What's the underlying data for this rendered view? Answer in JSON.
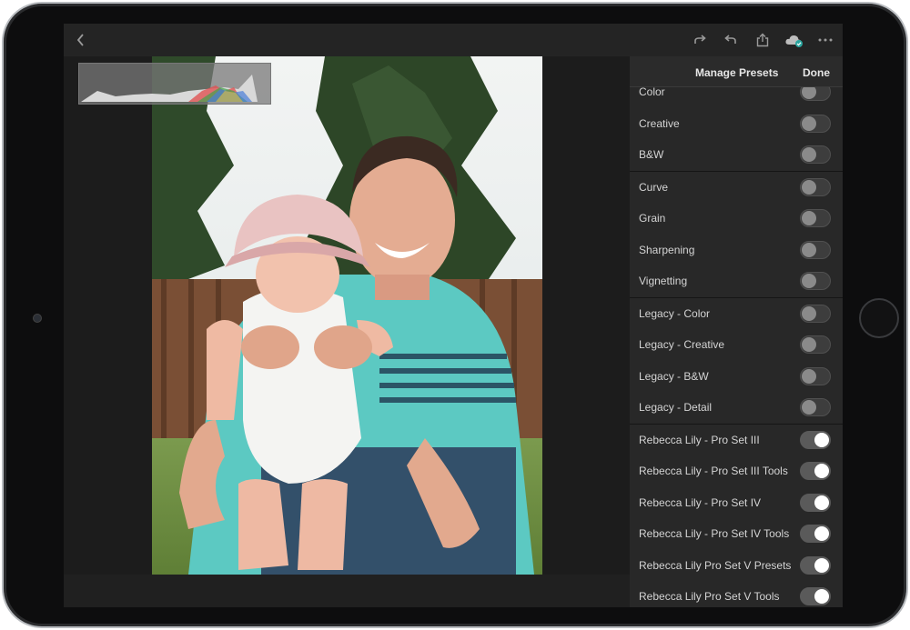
{
  "header": {
    "title": "Manage Presets",
    "done_label": "Done"
  },
  "toolbar": {
    "icons": [
      "back-icon",
      "redo-icon",
      "undo-icon",
      "share-icon",
      "cloud-sync-icon",
      "more-icon"
    ]
  },
  "colors": {
    "panel_bg": "#282828",
    "toggle_on": "#ffffff",
    "toggle_off": "#8a8a8a"
  },
  "presets": {
    "groups": [
      {
        "items": [
          {
            "label": "Color",
            "on": false
          },
          {
            "label": "Creative",
            "on": false
          },
          {
            "label": "B&W",
            "on": false
          }
        ]
      },
      {
        "items": [
          {
            "label": "Curve",
            "on": false
          },
          {
            "label": "Grain",
            "on": false
          },
          {
            "label": "Sharpening",
            "on": false
          },
          {
            "label": "Vignetting",
            "on": false
          }
        ]
      },
      {
        "items": [
          {
            "label": "Legacy - Color",
            "on": false
          },
          {
            "label": "Legacy - Creative",
            "on": false
          },
          {
            "label": "Legacy - B&W",
            "on": false
          },
          {
            "label": "Legacy - Detail",
            "on": false
          }
        ]
      },
      {
        "items": [
          {
            "label": "Rebecca Lily - Pro Set III",
            "on": true
          },
          {
            "label": "Rebecca Lily - Pro Set III Tools",
            "on": true
          },
          {
            "label": "Rebecca Lily - Pro Set IV",
            "on": true
          },
          {
            "label": "Rebecca Lily - Pro Set IV Tools",
            "on": true
          },
          {
            "label": "Rebecca Lily Pro Set V Presets",
            "on": true
          },
          {
            "label": "Rebecca Lily Pro Set V Tools",
            "on": true
          }
        ]
      }
    ]
  }
}
